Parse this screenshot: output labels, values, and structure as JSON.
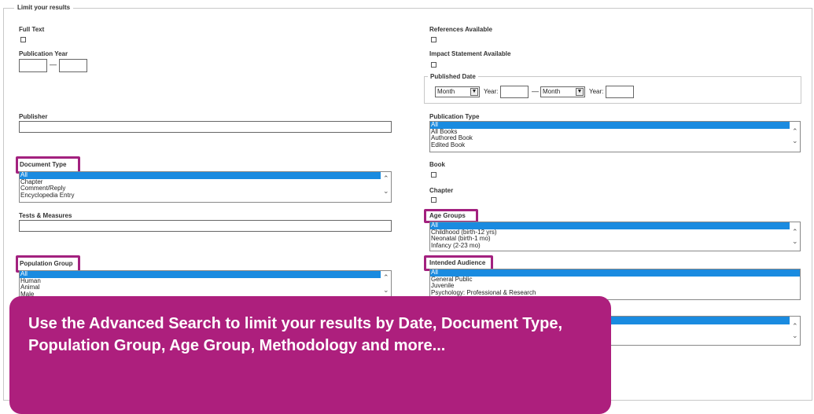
{
  "fieldset_legend": "Limit your results",
  "left": {
    "full_text": "Full Text",
    "publication_year": "Publication Year",
    "year_dash": "—",
    "publisher": "Publisher",
    "document_type": {
      "label": "Document Type",
      "options": [
        "All",
        "Chapter",
        "Comment/Reply",
        "Encyclopedia Entry"
      ]
    },
    "tests_measures": "Tests & Measures",
    "population_group": {
      "label": "Population Group",
      "options": [
        "All",
        "Human",
        "Animal",
        "Male"
      ]
    }
  },
  "right": {
    "references_available": "References Available",
    "impact_statement": "Impact Statement Available",
    "published_date": {
      "legend": "Published Date",
      "month1": "Month",
      "year_label1": "Year:",
      "dash": "—",
      "month2": "Month",
      "year_label2": "Year:"
    },
    "publication_type": {
      "label": "Publication Type",
      "options": [
        "All",
        "All Books",
        "Authored Book",
        "Edited Book"
      ]
    },
    "book": "Book",
    "chapter": "Chapter",
    "age_groups": {
      "label": "Age Groups",
      "options": [
        "All",
        "Childhood (birth-12 yrs)",
        "Neonatal (birth-1 mo)",
        "Infancy (2-23 mo)"
      ]
    },
    "intended_audience": {
      "label": "Intended Audience",
      "options": [
        "All",
        "General Public",
        "Juvenile",
        "Psychology: Professional & Research"
      ]
    }
  },
  "banner": {
    "text": "Use the Advanced Search to limit your results by Date, Document Type, Population Group, Age Group, Methodology and more..."
  },
  "colors": {
    "highlight": "#a3217f",
    "banner": "#ad1f7d",
    "selected_option": "#1a8be0"
  },
  "icons": {
    "scroll_up": "chevron-up-icon",
    "scroll_down": "chevron-down-icon",
    "dropdown": "dropdown-arrow-icon"
  }
}
